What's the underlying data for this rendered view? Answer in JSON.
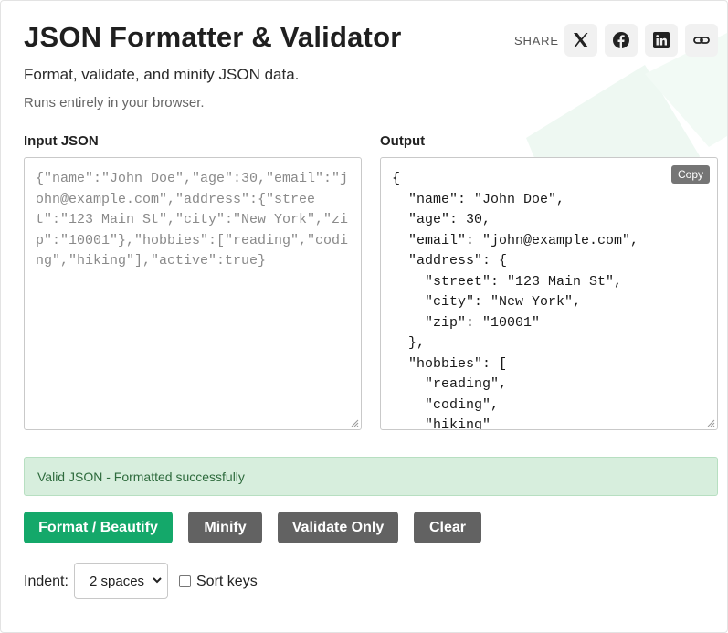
{
  "header": {
    "title": "JSON Formatter & Validator",
    "subtitle": "Format, validate, and minify JSON data.",
    "note": "Runs entirely in your browser."
  },
  "share": {
    "label": "SHARE",
    "buttons": [
      {
        "icon": "x-twitter-icon"
      },
      {
        "icon": "facebook-icon"
      },
      {
        "icon": "linkedin-icon"
      },
      {
        "icon": "link-icon"
      }
    ]
  },
  "input": {
    "label": "Input JSON",
    "value": "{\"name\":\"John Doe\",\"age\":30,\"email\":\"john@example.com\",\"address\":{\"street\":\"123 Main St\",\"city\":\"New York\",\"zip\":\"10001\"},\"hobbies\":[\"reading\",\"coding\",\"hiking\"],\"active\":true}"
  },
  "output": {
    "label": "Output",
    "copy_label": "Copy",
    "value": "{\n  \"name\": \"John Doe\",\n  \"age\": 30,\n  \"email\": \"john@example.com\",\n  \"address\": {\n    \"street\": \"123 Main St\",\n    \"city\": \"New York\",\n    \"zip\": \"10001\"\n  },\n  \"hobbies\": [\n    \"reading\",\n    \"coding\",\n    \"hiking\""
  },
  "status": {
    "text": "Valid JSON - Formatted successfully",
    "color": "#2e6b3d",
    "background": "#d7eedd"
  },
  "actions": {
    "format": "Format / Beautify",
    "minify": "Minify",
    "validate": "Validate Only",
    "clear": "Clear"
  },
  "options": {
    "indent_label": "Indent:",
    "indent_value": "2 spaces",
    "sort_keys_label": "Sort keys",
    "sort_keys_checked": false
  },
  "colors": {
    "accent": "#14a86a",
    "secondary_button": "#626262"
  }
}
